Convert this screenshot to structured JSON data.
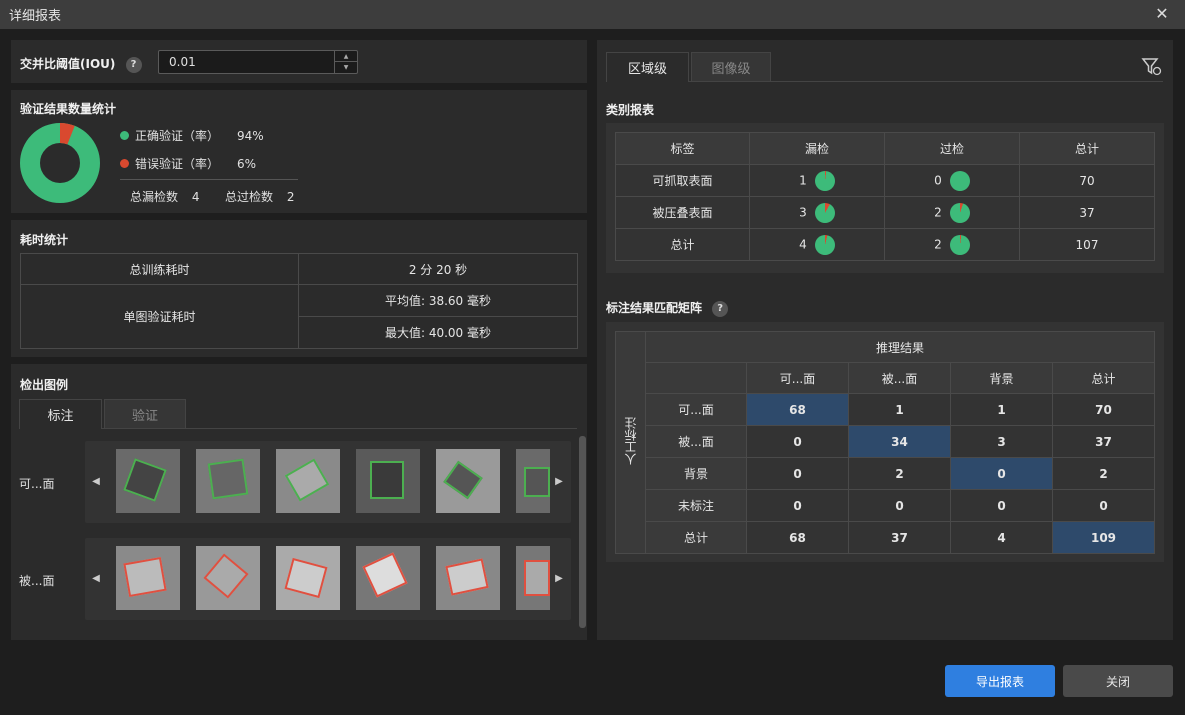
{
  "window": {
    "title": "详细报表"
  },
  "iou": {
    "label": "交并比阈值(IOU)",
    "help": "?",
    "value": "0.01"
  },
  "verify": {
    "title": "验证结果数量统计",
    "correct_label": "正确验证（率）",
    "correct_value": "94%",
    "wrong_label": "错误验证（率）",
    "wrong_value": "6%",
    "correct_ratio": 0.94,
    "miss_label": "总漏检数",
    "miss_value": "4",
    "over_label": "总过检数",
    "over_value": "2",
    "colors": {
      "correct": "#3dbb7a",
      "wrong": "#d9492f"
    }
  },
  "timing": {
    "title": "耗时统计",
    "train_label": "总训练耗时",
    "train_value": "2 分 20 秒",
    "single_label": "单图验证耗时",
    "avg": "平均值: 38.60 毫秒",
    "max": "最大值: 40.00 毫秒"
  },
  "examples": {
    "title": "检出图例",
    "tabs": [
      "标注",
      "验证"
    ],
    "rows": [
      {
        "label": "可...面"
      },
      {
        "label": "被...面"
      }
    ]
  },
  "right_tabs": [
    "区域级",
    "图像级"
  ],
  "filter_icon": "filter-icon",
  "category": {
    "title": "类别报表",
    "headers": [
      "标签",
      "漏检",
      "过检",
      "总计"
    ],
    "rows": [
      {
        "label": "可抓取表面",
        "miss": "1",
        "miss_ratio": 0.02,
        "over": "0",
        "over_ratio": 0.0,
        "total": "70"
      },
      {
        "label": "被压叠表面",
        "miss": "3",
        "miss_ratio": 0.08,
        "over": "2",
        "over_ratio": 0.05,
        "total": "37"
      },
      {
        "label": "总计",
        "miss": "4",
        "miss_ratio": 0.04,
        "over": "2",
        "over_ratio": 0.02,
        "total": "107"
      }
    ]
  },
  "matrix": {
    "title": "标注结果匹配矩阵",
    "help": "?",
    "top_header": "推理结果",
    "side_header": "人工标注",
    "cols": [
      "可...面",
      "被...面",
      "背景",
      "总计"
    ],
    "rows": [
      {
        "label": "可...面",
        "values": [
          "68",
          "1",
          "1",
          "70"
        ]
      },
      {
        "label": "被...面",
        "values": [
          "0",
          "34",
          "3",
          "37"
        ]
      },
      {
        "label": "背景",
        "values": [
          "0",
          "2",
          "0",
          "2"
        ]
      },
      {
        "label": "未标注",
        "values": [
          "0",
          "0",
          "0",
          "0"
        ]
      },
      {
        "label": "总计",
        "values": [
          "68",
          "37",
          "4",
          "109"
        ]
      }
    ]
  },
  "buttons": {
    "export": "导出报表",
    "close": "关闭"
  }
}
